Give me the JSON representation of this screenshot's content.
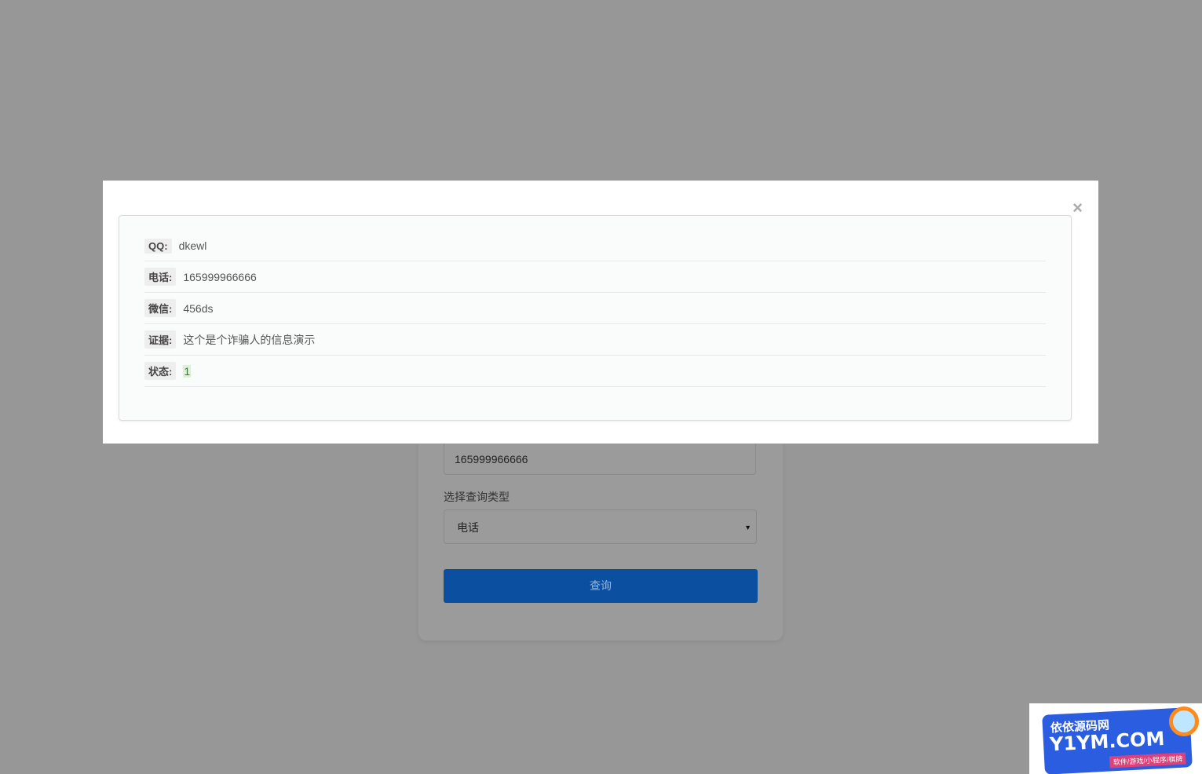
{
  "form": {
    "query_value": "165999966666",
    "type_label": "选择查询类型",
    "type_selected": "电话",
    "submit_label": "查询"
  },
  "modal": {
    "close_glyph": "×",
    "rows": [
      {
        "label": "QQ:",
        "value": "dkewl"
      },
      {
        "label": "电话:",
        "value": "165999966666"
      },
      {
        "label": "微信:",
        "value": "456ds"
      },
      {
        "label": "证据:",
        "value": "这个是个诈骗人的信息演示"
      },
      {
        "label": "状态:",
        "value": "1"
      }
    ]
  },
  "watermark": {
    "title": "依依源码网",
    "domain": "Y1YM.COM",
    "tagline": "软件/游戏/小程序/棋牌"
  },
  "colors": {
    "overlay": "#979797",
    "primary_button": "#0a4fa0",
    "status_bg": "#dff0d8"
  }
}
